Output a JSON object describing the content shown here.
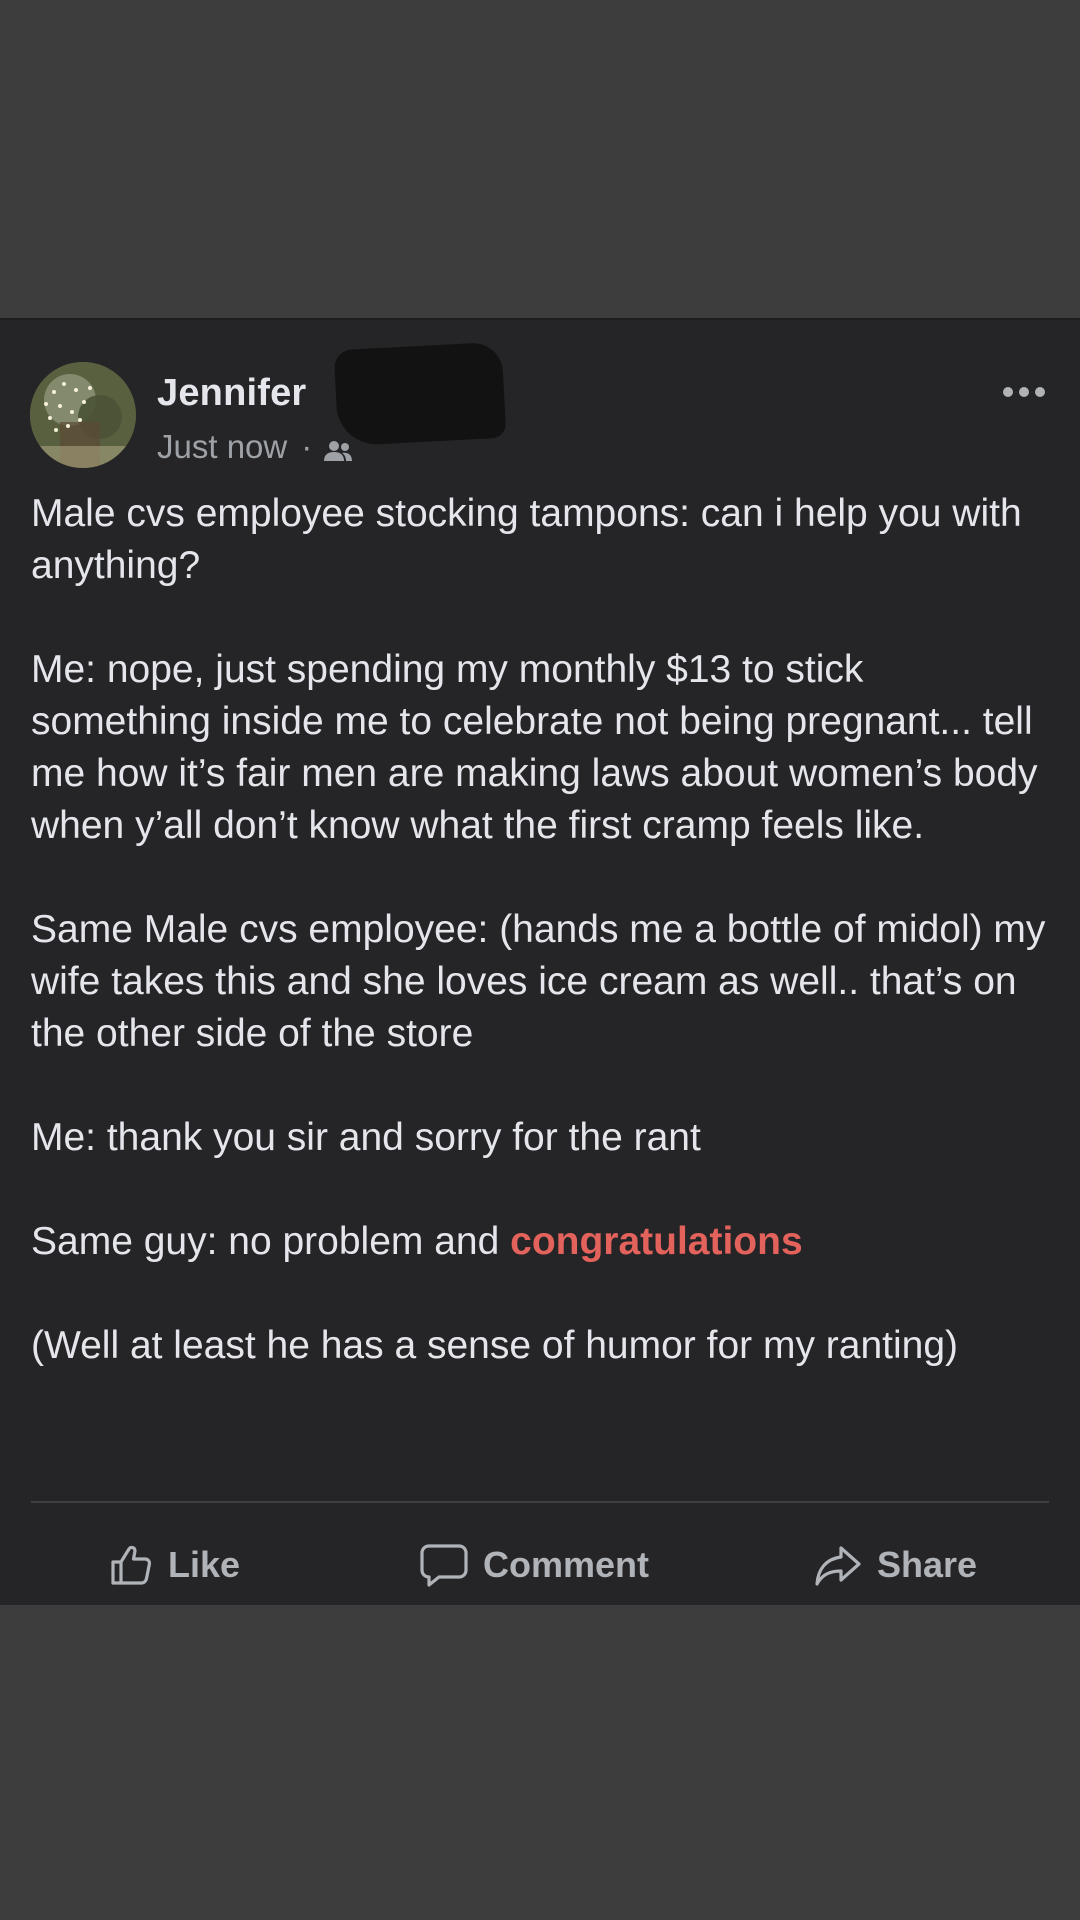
{
  "post": {
    "author_name": "Jennifer",
    "timestamp": "Just now",
    "separator": "·",
    "audience_icon": "friends-icon",
    "paragraphs": [
      "Male cvs employee stocking tampons: can i help you with anything?",
      "Me: nope, just spending my monthly $13 to stick something inside me to celebrate not being pregnant... tell me how it’s fair men are making laws about women’s body when y’all don’t know what the first cramp feels like.",
      "Same Male cvs employee: (hands me a bottle of midol) my wife takes this and she loves ice cream as well.. that’s on the other side of the store",
      "Me: thank you sir and sorry for the rant"
    ],
    "paragraph5_prefix": "Same guy: no problem and ",
    "paragraph5_highlight": "congratulations",
    "paragraph6": "(Well at least he has a sense of humor for my ranting)"
  },
  "actions": {
    "like_label": "Like",
    "comment_label": "Comment",
    "share_label": "Share"
  },
  "colors": {
    "background": "#3d3d3e",
    "card": "#252527",
    "text": "#e4e6eb",
    "muted": "#9ea1a6",
    "highlight": "#e4625c"
  }
}
